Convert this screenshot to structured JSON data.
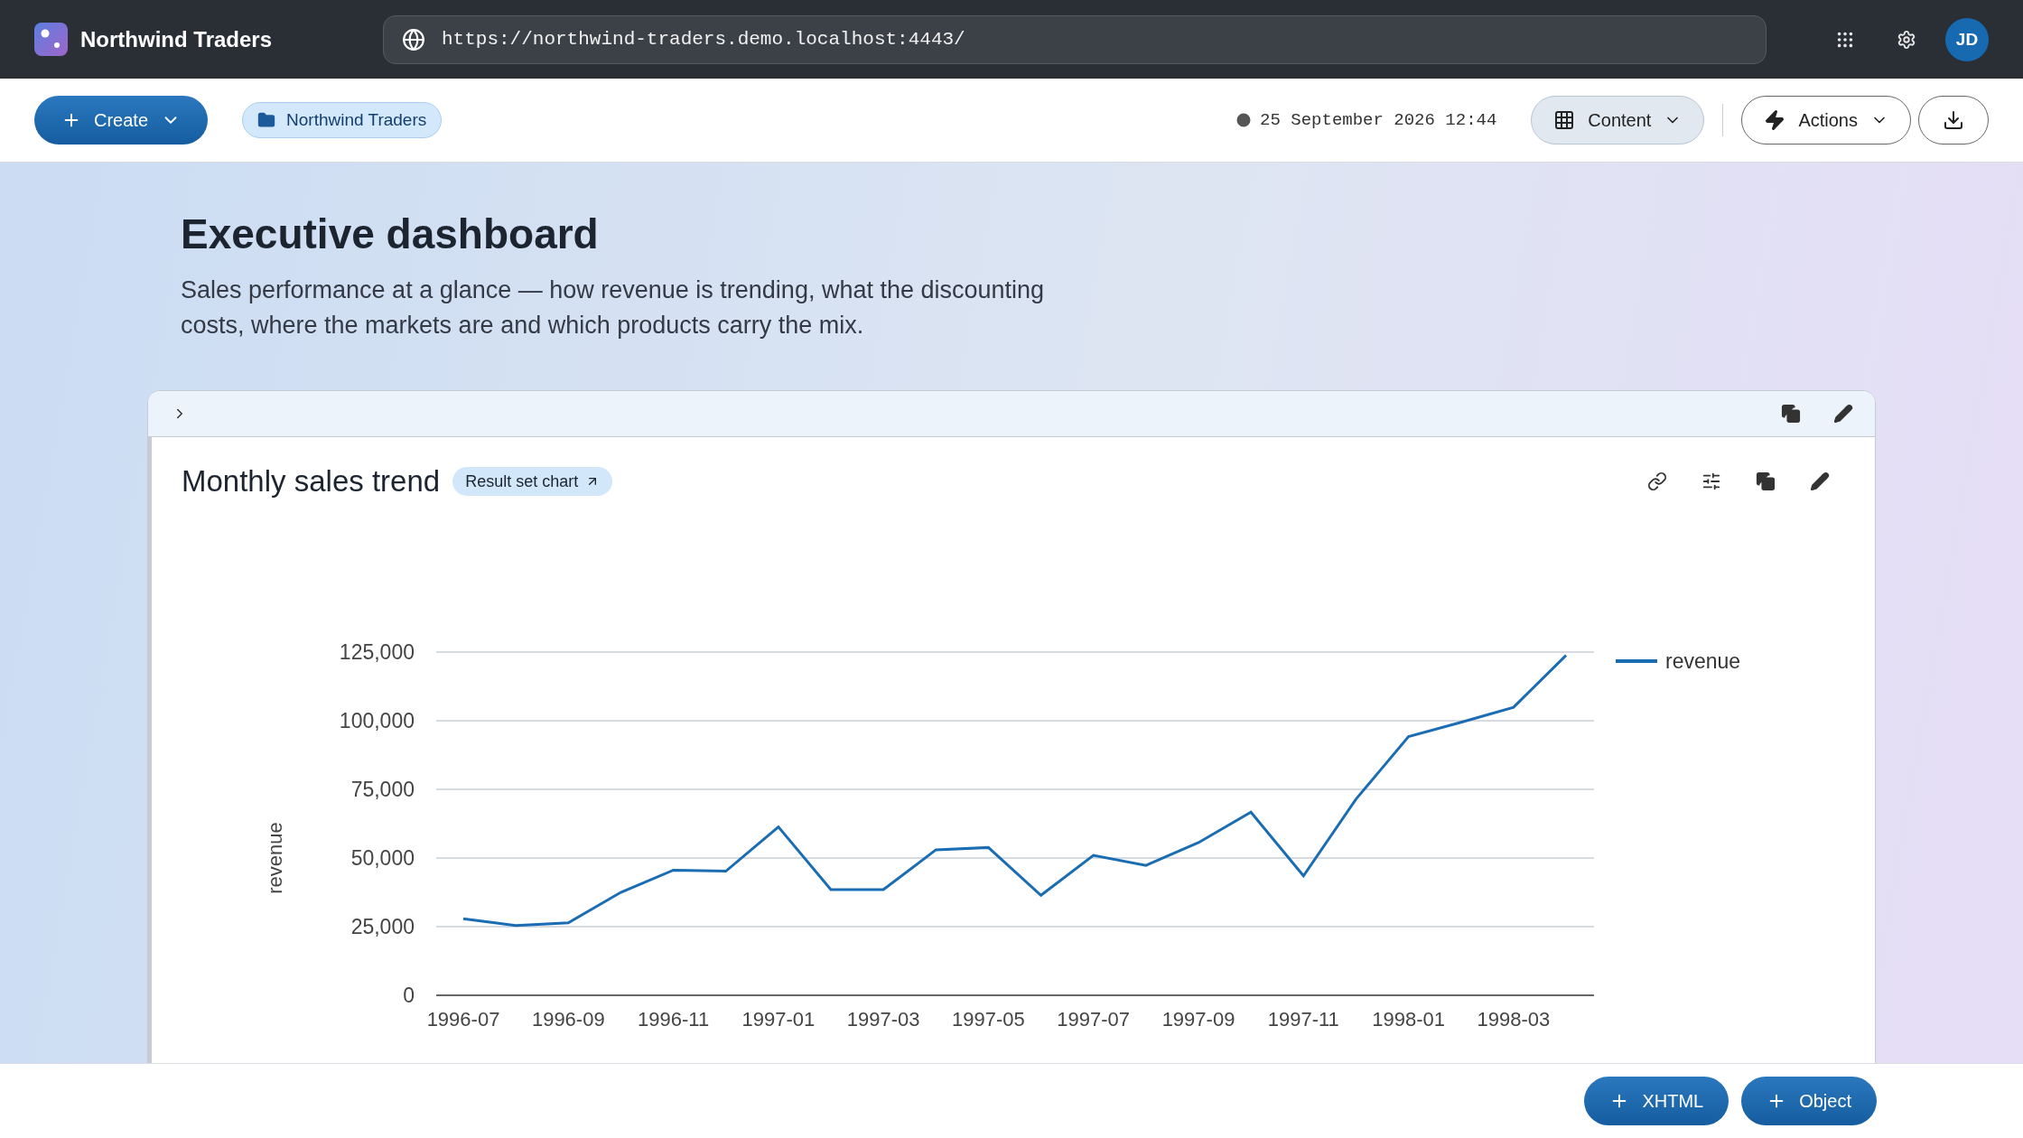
{
  "app": {
    "name": "Northwind Traders"
  },
  "address_bar": {
    "url": "https://northwind-traders.demo.localhost:4443/"
  },
  "user": {
    "initials": "JD"
  },
  "toolbar": {
    "create": "Create",
    "workspace": "Northwind Traders",
    "timestamp": "25 September 2026 12:44",
    "content": "Content",
    "actions": "Actions"
  },
  "page": {
    "title": "Executive dashboard",
    "description": "Sales performance at a glance — how revenue is trending, what the discounting costs, where the markets are and which products carry the mix."
  },
  "panel": {
    "expanded": false,
    "title": "Monthly sales trend",
    "badge": "Result set chart",
    "chart_data": {
      "type": "line",
      "ylabel": "revenue",
      "grid": true,
      "categories": [
        "1996-07",
        null,
        "1996-09",
        null,
        "1996-11",
        null,
        "1997-01",
        null,
        "1997-03",
        null,
        "1997-05",
        null,
        "1997-07",
        null,
        "1997-09",
        null,
        "1997-11",
        null,
        "1998-01",
        null,
        "1998-03",
        null
      ],
      "series": [
        {
          "name": "revenue",
          "color": "#1a6db3",
          "values": [
            27900,
            25400,
            26400,
            37500,
            45600,
            45200,
            61300,
            38500,
            38500,
            53000,
            53800,
            36400,
            51000,
            47300,
            55600,
            66700,
            43500,
            71400,
            94200,
            99400,
            104900,
            123800
          ]
        }
      ],
      "ylim": [
        0,
        125000
      ],
      "yticks": [
        {
          "value": 0,
          "label": "0"
        },
        {
          "value": 25000,
          "label": "25,000"
        },
        {
          "value": 50000,
          "label": "50,000"
        },
        {
          "value": 75000,
          "label": "75,000"
        },
        {
          "value": 100000,
          "label": "100,000"
        },
        {
          "value": 125000,
          "label": "125,000"
        }
      ]
    }
  },
  "footer_buttons": [
    "XHTML",
    "Object"
  ]
}
